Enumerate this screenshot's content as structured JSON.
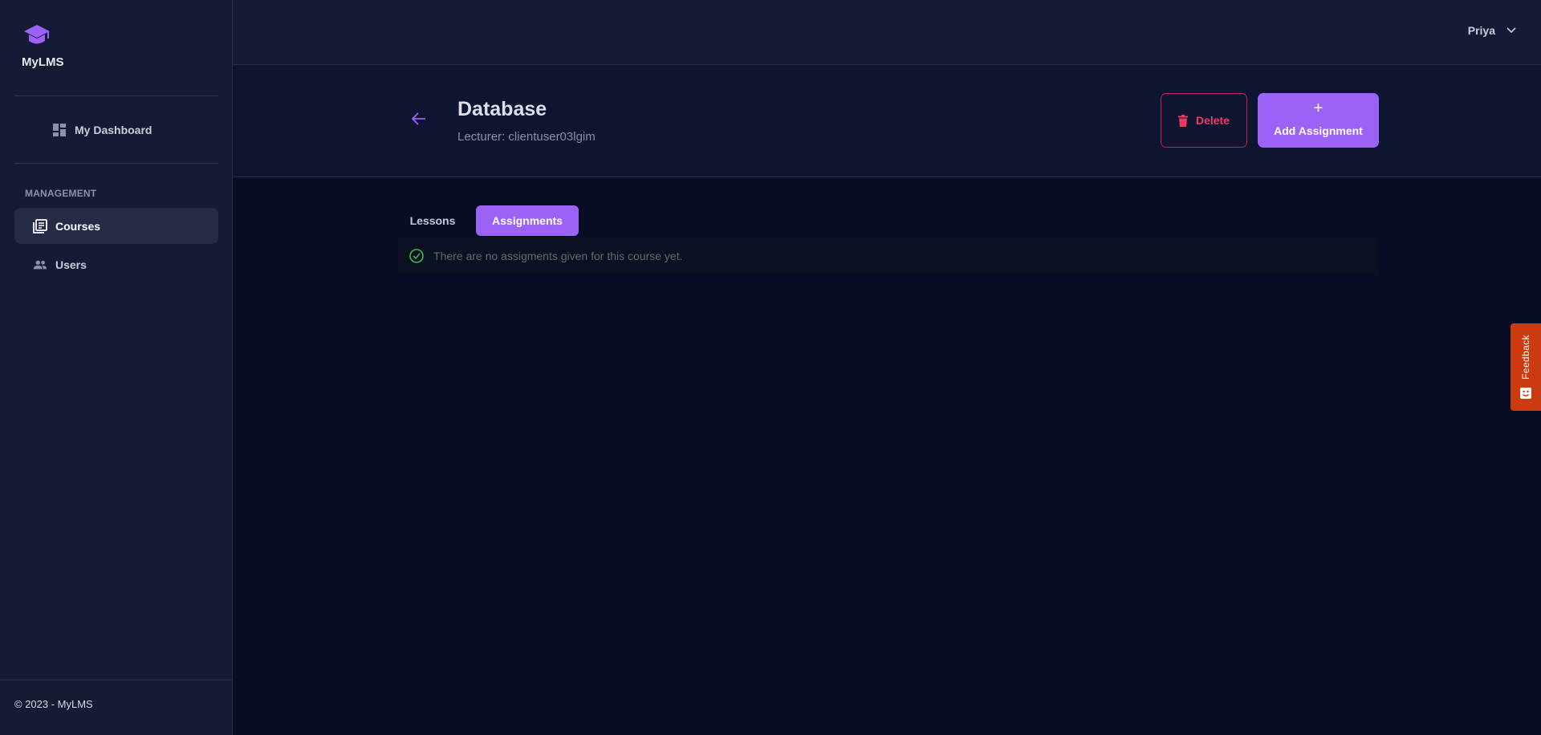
{
  "app": {
    "name": "MyLMS"
  },
  "sidebar": {
    "dashboard_label": "My Dashboard",
    "section_label": "MANAGEMENT",
    "items": [
      {
        "label": "Courses",
        "icon": "courses-icon",
        "active": true
      },
      {
        "label": "Users",
        "icon": "users-icon",
        "active": false
      }
    ],
    "footer": "© 2023 - MyLMS"
  },
  "topbar": {
    "user_name": "Priya"
  },
  "course": {
    "title": "Database",
    "lecturer": "Lecturer: clientuser03lgim"
  },
  "actions": {
    "delete_label": "Delete",
    "add_plus": "+",
    "add_label": "Add Assignment"
  },
  "tabs": [
    {
      "label": "Lessons",
      "active": false
    },
    {
      "label": "Assignments",
      "active": true
    }
  ],
  "empty_state": {
    "message": "There are no assigments given for this course yet."
  },
  "feedback": {
    "label": "Feedback"
  },
  "colors": {
    "accent": "#9b62f5",
    "danger": "#f23760",
    "success": "#3fb950",
    "background": "#080d24",
    "sidebar": "#161b35",
    "feedback": "#cc3a0f"
  }
}
